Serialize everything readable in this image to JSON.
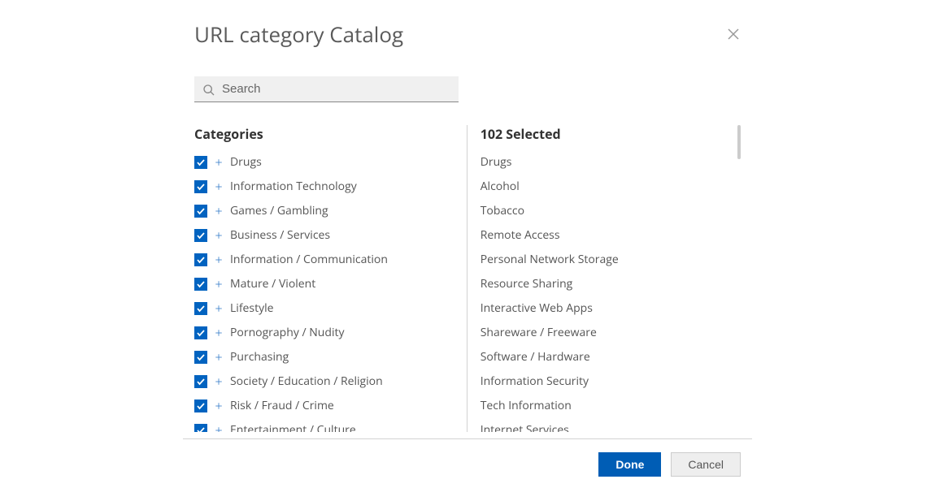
{
  "dialog": {
    "title": "URL category Catalog"
  },
  "search": {
    "placeholder": "Search",
    "value": ""
  },
  "categories_heading": "Categories",
  "categories": [
    {
      "label": "Drugs"
    },
    {
      "label": "Information Technology"
    },
    {
      "label": "Games / Gambling"
    },
    {
      "label": "Business / Services"
    },
    {
      "label": "Information / Communication"
    },
    {
      "label": "Mature / Violent"
    },
    {
      "label": "Lifestyle"
    },
    {
      "label": "Pornography / Nudity"
    },
    {
      "label": "Purchasing"
    },
    {
      "label": "Society / Education / Religion"
    },
    {
      "label": "Risk / Fraud / Crime"
    },
    {
      "label": "Entertainment / Culture"
    }
  ],
  "selected_heading": "102 Selected",
  "selected": [
    {
      "label": "Drugs"
    },
    {
      "label": "Alcohol"
    },
    {
      "label": "Tobacco"
    },
    {
      "label": "Remote Access"
    },
    {
      "label": "Personal Network Storage"
    },
    {
      "label": "Resource Sharing"
    },
    {
      "label": "Interactive Web Apps"
    },
    {
      "label": "Shareware / Freeware"
    },
    {
      "label": "Software / Hardware"
    },
    {
      "label": "Information Security"
    },
    {
      "label": "Tech Information"
    },
    {
      "label": "Internet Services"
    }
  ],
  "buttons": {
    "done": "Done",
    "cancel": "Cancel"
  }
}
